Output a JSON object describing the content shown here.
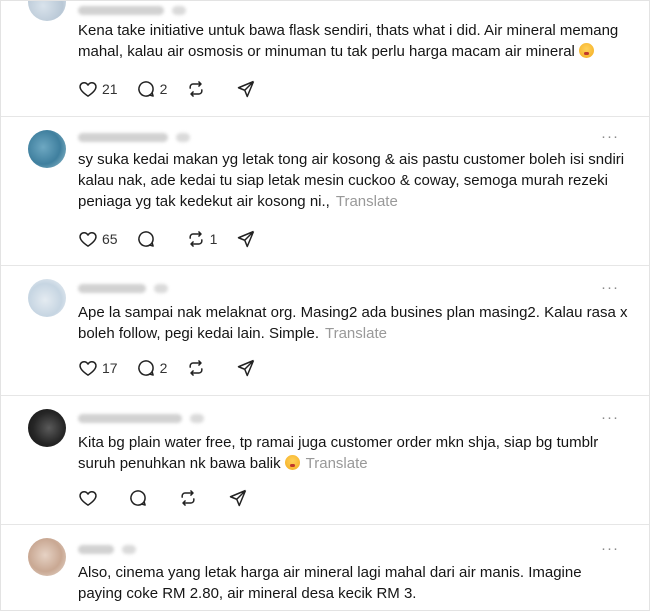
{
  "posts": [
    {
      "text": "Kena take initiative untuk bawa flask sendiri, thats what i did. Air mineral memang mahal, kalau air osmosis or minuman tu tak perlu harga macam air mineral",
      "emoji": true,
      "translate": "",
      "likes": "21",
      "replies": "2",
      "reposts": ""
    },
    {
      "text": "sy suka kedai makan yg letak tong air kosong & ais pastu customer boleh isi sndiri kalau nak, ade kedai tu siap letak mesin cuckoo & coway, semoga murah rezeki peniaga yg tak kedekut air kosong ni.,",
      "emoji": false,
      "translate": "Translate",
      "likes": "65",
      "replies": "",
      "reposts": "1"
    },
    {
      "text": "Ape la sampai nak melaknat org. Masing2 ada busines plan masing2. Kalau rasa x boleh follow, pegi kedai lain. Simple.",
      "emoji": false,
      "translate": "Translate",
      "likes": "17",
      "replies": "2",
      "reposts": ""
    },
    {
      "text": "Kita bg plain water free, tp ramai juga customer order mkn shja, siap bg tumblr suruh penuhkan nk bawa balik",
      "emoji": true,
      "translate": "Translate",
      "likes": "",
      "replies": "",
      "reposts": ""
    },
    {
      "text": "Also, cinema yang letak harga air mineral lagi mahal dari air manis. Imagine paying coke RM 2.80, air mineral desa kecik RM 3.",
      "emoji": false,
      "translate": "",
      "likes": "",
      "replies": "",
      "reposts": ""
    }
  ],
  "more_glyph": "···",
  "icons": [
    "heart-icon",
    "reply-icon",
    "repost-icon",
    "share-icon",
    "more-icon"
  ]
}
